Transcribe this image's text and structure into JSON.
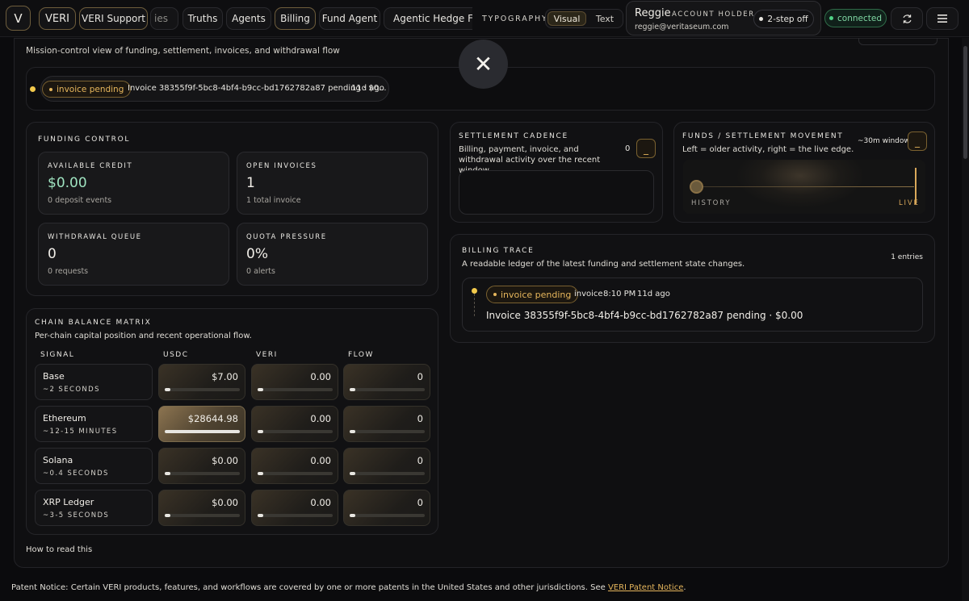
{
  "topbar": {
    "brand_letter": "V",
    "nav": [
      "VERI",
      "VERI Support",
      "ies",
      "Truths",
      "Agents",
      "Billing",
      "Fund Agent",
      "Agentic Hedge Fund"
    ],
    "typography_label": "TYPOGRAPHY",
    "typography_options": [
      "Visual",
      "Text"
    ],
    "account": {
      "name": "Reggie",
      "role": "ACCOUNT HOLDER",
      "email": "reggie@veritaseum.com",
      "two_step": "2-step off"
    },
    "status": "connected",
    "refresh_icon": "refresh-icon",
    "menu_icon": "hamburger-menu-icon"
  },
  "header": {
    "subtitle": "Mission-control view of funding, settlement, invoices, and withdrawal flow",
    "close_icon": "✕"
  },
  "alert": {
    "badge": "invoice pending",
    "text": "Invoice 38355f9f-5bc8-4bf4-b9cc-bd1762782a87 pending · $0...",
    "ago": "11d ago"
  },
  "funding": {
    "title": "FUNDING CONTROL",
    "stats": [
      {
        "label": "AVAILABLE CREDIT",
        "value": "$0.00",
        "sub": "0 deposit events"
      },
      {
        "label": "OPEN INVOICES",
        "value": "1",
        "sub": "1 total invoice"
      },
      {
        "label": "WITHDRAWAL QUEUE",
        "value": "0",
        "sub": "0 requests"
      },
      {
        "label": "QUOTA PRESSURE",
        "value": "0%",
        "sub": "0 alerts"
      }
    ]
  },
  "matrix": {
    "title": "CHAIN BALANCE MATRIX",
    "desc": "Per-chain capital position and recent operational flow.",
    "columns": [
      "SIGNAL",
      "USDC",
      "VERI",
      "FLOW"
    ],
    "rows": [
      {
        "name": "Base",
        "time": "~2 SECONDS",
        "usdc": "$7.00",
        "veri": "0.00",
        "flow": "0",
        "usdc_level": 0.08
      },
      {
        "name": "Ethereum",
        "time": "~12-15 MINUTES",
        "usdc": "$28644.98",
        "veri": "0.00",
        "flow": "0",
        "usdc_level": 1.0
      },
      {
        "name": "Solana",
        "time": "~0.4 SECONDS",
        "usdc": "$0.00",
        "veri": "0.00",
        "flow": "0",
        "usdc_level": 0.08
      },
      {
        "name": "XRP Ledger",
        "time": "~3-5 SECONDS",
        "usdc": "$0.00",
        "veri": "0.00",
        "flow": "0",
        "usdc_level": 0.08
      }
    ],
    "min_level": 0.08
  },
  "cadence": {
    "title": "SETTLEMENT CADENCE",
    "desc": "Billing, payment, invoice, and withdrawal activity over the recent window.",
    "count": "0",
    "button": "_"
  },
  "movement": {
    "title": "FUNDS / SETTLEMENT MOVEMENT",
    "desc": "Left = older activity, right = the live edge.",
    "window": "~30m window",
    "button": "_",
    "history": "HISTORY",
    "live": "LIVE"
  },
  "trace": {
    "title": "BILLING TRACE",
    "desc": "A readable ledger of the latest funding and settlement state changes.",
    "entries_count": "1 entries",
    "entry": {
      "badge": "invoice pending",
      "kind": "invoice",
      "time": "8:10 PM",
      "ago": "11d ago",
      "text": "Invoice 38355f9f-5bc8-4bf4-b9cc-bd1762782a87 pending · $0.00"
    }
  },
  "how_to_read": "How to read this",
  "footer": {
    "text": "Patent Notice: Certain VERI products, features, and workflows are covered by one or more patents in the United States and other jurisdictions. See ",
    "link": "VERI Patent Notice",
    "end": "."
  }
}
